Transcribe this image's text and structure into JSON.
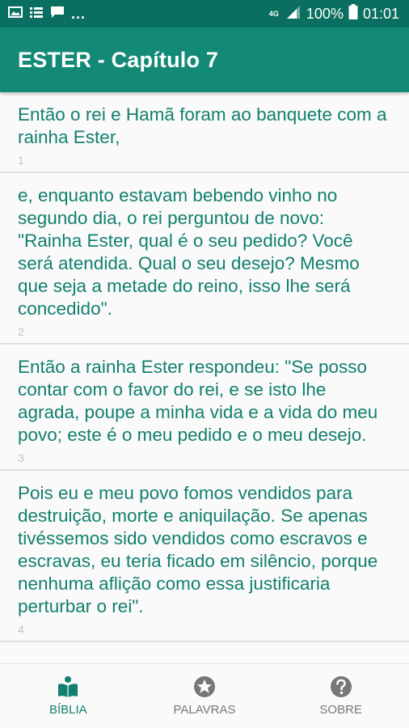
{
  "status_bar": {
    "ellipsis": "...",
    "network": "4G",
    "battery": "100%",
    "time": "01:01",
    "icons": [
      "image-icon",
      "list-icon",
      "message-icon",
      "signal-icon",
      "battery-icon"
    ]
  },
  "app_bar": {
    "title": "ESTER - Capítulo 7"
  },
  "verses": [
    {
      "text": "Então o rei e Hamã foram ao banquete com a rainha Ester,",
      "number": "1"
    },
    {
      "text": "e, enquanto estavam bebendo vinho no segundo dia, o rei perguntou de novo: \"Rainha Ester, qual é o seu pedido? Você será atendida. Qual o seu desejo? Mesmo que seja a metade do reino, isso lhe será concedido\".",
      "number": "2"
    },
    {
      "text": "Então a rainha Ester respondeu: \"Se posso contar com o favor do rei, e se isto lhe agrada, poupe a minha vida e a vida do meu povo; este é o meu pedido e o meu desejo.",
      "number": "3"
    },
    {
      "text": "Pois eu e meu povo fomos vendidos para destruição, morte e aniquilação. Se apenas tivéssemos sido vendidos como escravos e escravas, eu teria ficado em silêncio, porque nenhuma aflição como essa justificaria perturbar o rei\".",
      "number": "4"
    }
  ],
  "bottom_nav": [
    {
      "label": "BÍBLIA",
      "icon": "bible-reader-icon",
      "active": true
    },
    {
      "label": "PALAVRAS",
      "icon": "star-circle-icon",
      "active": false
    },
    {
      "label": "SOBRE",
      "icon": "help-circle-icon",
      "active": false
    }
  ],
  "colors": {
    "status_bar": "#0a6f60",
    "app_bar": "#128a76",
    "accent_text": "#12806e",
    "inactive": "#777777"
  }
}
